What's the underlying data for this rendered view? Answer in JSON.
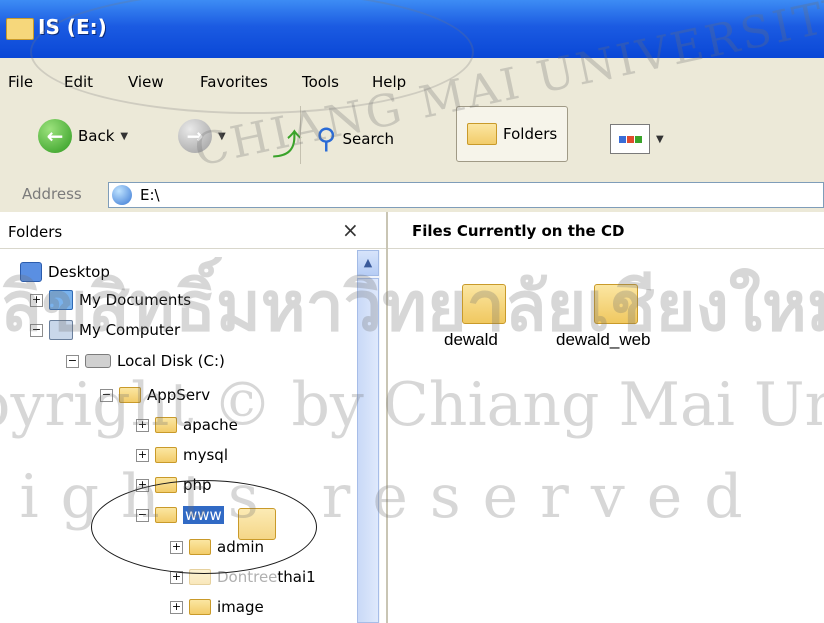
{
  "window": {
    "title": "IS (E:)"
  },
  "menu": [
    "File",
    "Edit",
    "View",
    "Favorites",
    "Tools",
    "Help"
  ],
  "toolbar": {
    "back_label": "Back",
    "search_label": "Search",
    "folders_label": "Folders"
  },
  "address": {
    "label": "Address",
    "value": "E:\\"
  },
  "folders_pane": {
    "title": "Folders",
    "close_symbol": "×",
    "tree": [
      {
        "label": "Desktop",
        "expander": ""
      },
      {
        "label": "My Documents",
        "expander": "+"
      },
      {
        "label": "My Computer",
        "expander": "−"
      },
      {
        "label": "Local Disk (C:)",
        "expander": "−"
      },
      {
        "label": "AppServ",
        "expander": "−"
      },
      {
        "label": "apache",
        "expander": "+"
      },
      {
        "label": "mysql",
        "expander": "+"
      },
      {
        "label": "php",
        "expander": "+"
      },
      {
        "label": "www",
        "expander": "−",
        "selected": true
      },
      {
        "label": "admin",
        "expander": "+"
      },
      {
        "label": "Dontree",
        "label_suffix": "thai1",
        "expander": "+"
      },
      {
        "label": "image",
        "expander": "+"
      }
    ]
  },
  "content": {
    "title": "Files Currently on the CD",
    "items": [
      {
        "name": "dewald"
      },
      {
        "name": "dewald_web"
      }
    ]
  },
  "watermark": {
    "line1": "ลิขสิทธิ์มหาวิทยาลัยเชียงใหม่",
    "line2": "Copyright © by Chiang Mai University",
    "line3": "All rights reserved",
    "seal": "CHIANG MAI UNIVERSITY"
  },
  "colors": {
    "titlebar": "#0a47d6",
    "chrome": "#ece9d8",
    "selection": "#316ac5"
  }
}
